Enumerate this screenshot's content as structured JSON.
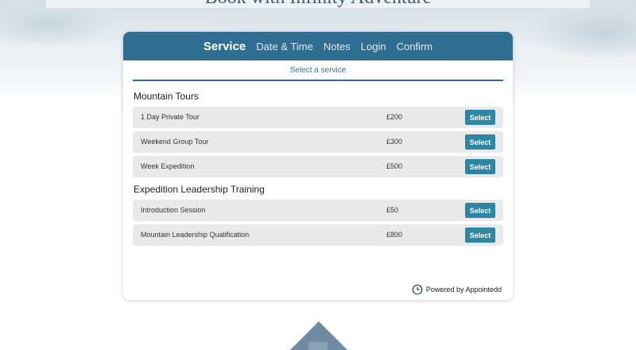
{
  "banner": {
    "title": "Book with Infinity Adventure"
  },
  "nav": {
    "items": [
      {
        "label": "Service",
        "active": true
      },
      {
        "label": "Date & Time",
        "active": false
      },
      {
        "label": "Notes",
        "active": false
      },
      {
        "label": "Login",
        "active": false
      },
      {
        "label": "Confirm",
        "active": false
      }
    ]
  },
  "subhead": "Select a service",
  "categories": [
    {
      "title": "Mountain Tours",
      "services": [
        {
          "name": "1 Day Private Tour",
          "price": "£200",
          "button": "Select"
        },
        {
          "name": "Weekend Group Tour",
          "price": "£300",
          "button": "Select"
        },
        {
          "name": "Week Expedition",
          "price": "£500",
          "button": "Select"
        }
      ]
    },
    {
      "title": "Expedition Leadership Training",
      "services": [
        {
          "name": "Introduction Session",
          "price": "£50",
          "button": "Select"
        },
        {
          "name": "Mountain Leadership Qualification",
          "price": "£800",
          "button": "Select"
        }
      ]
    }
  ],
  "footer": {
    "powered_by": "Powered by Appointedd",
    "icon": "clock-icon"
  },
  "colors": {
    "primary": "#2f6e92",
    "button": "#2f86a4",
    "row_bg": "#e9e9e9"
  }
}
